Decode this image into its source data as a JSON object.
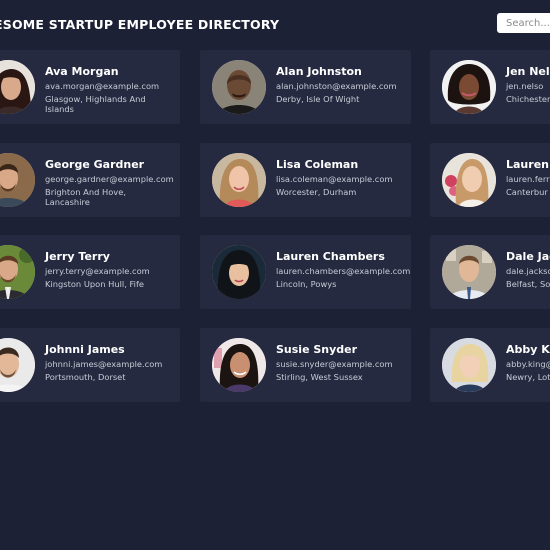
{
  "header": {
    "title": "ESOME STARTUP EMPLOYEE DIRECTORY",
    "search_placeholder": "Search..."
  },
  "employees": [
    {
      "name": "Ava Morgan",
      "email": "ava.morgan@example.com",
      "location": "Glasgow, Highlands And Islands"
    },
    {
      "name": "Alan Johnston",
      "email": "alan.johnston@example.com",
      "location": "Derby, Isle Of Wight"
    },
    {
      "name": "Jen Nels",
      "email": "jen.nelso",
      "location": "Chichester"
    },
    {
      "name": "George Gardner",
      "email": "george.gardner@example.com",
      "location": "Brighton And Hove, Lancashire"
    },
    {
      "name": "Lisa Coleman",
      "email": "lisa.coleman@example.com",
      "location": "Worcester, Durham"
    },
    {
      "name": "Lauren F",
      "email": "lauren.ferr",
      "location": "Canterbur"
    },
    {
      "name": "Jerry Terry",
      "email": "jerry.terry@example.com",
      "location": "Kingston Upon Hull, Fife"
    },
    {
      "name": "Lauren Chambers",
      "email": "lauren.chambers@example.com",
      "location": "Lincoln, Powys"
    },
    {
      "name": "Dale Jac",
      "email": "dale.jackso",
      "location": "Belfast, Soi"
    },
    {
      "name": "Johnni James",
      "email": "johnni.james@example.com",
      "location": "Portsmouth, Dorset"
    },
    {
      "name": "Susie Snyder",
      "email": "susie.snyder@example.com",
      "location": "Stirling, West Sussex"
    },
    {
      "name": "Abby Kin",
      "email": "abby.king@",
      "location": "Newry, Loth"
    }
  ],
  "colors": {
    "background": "#1d2135",
    "card": "#252a40",
    "text_primary": "#ffffff",
    "text_secondary": "#c9cbd6"
  }
}
